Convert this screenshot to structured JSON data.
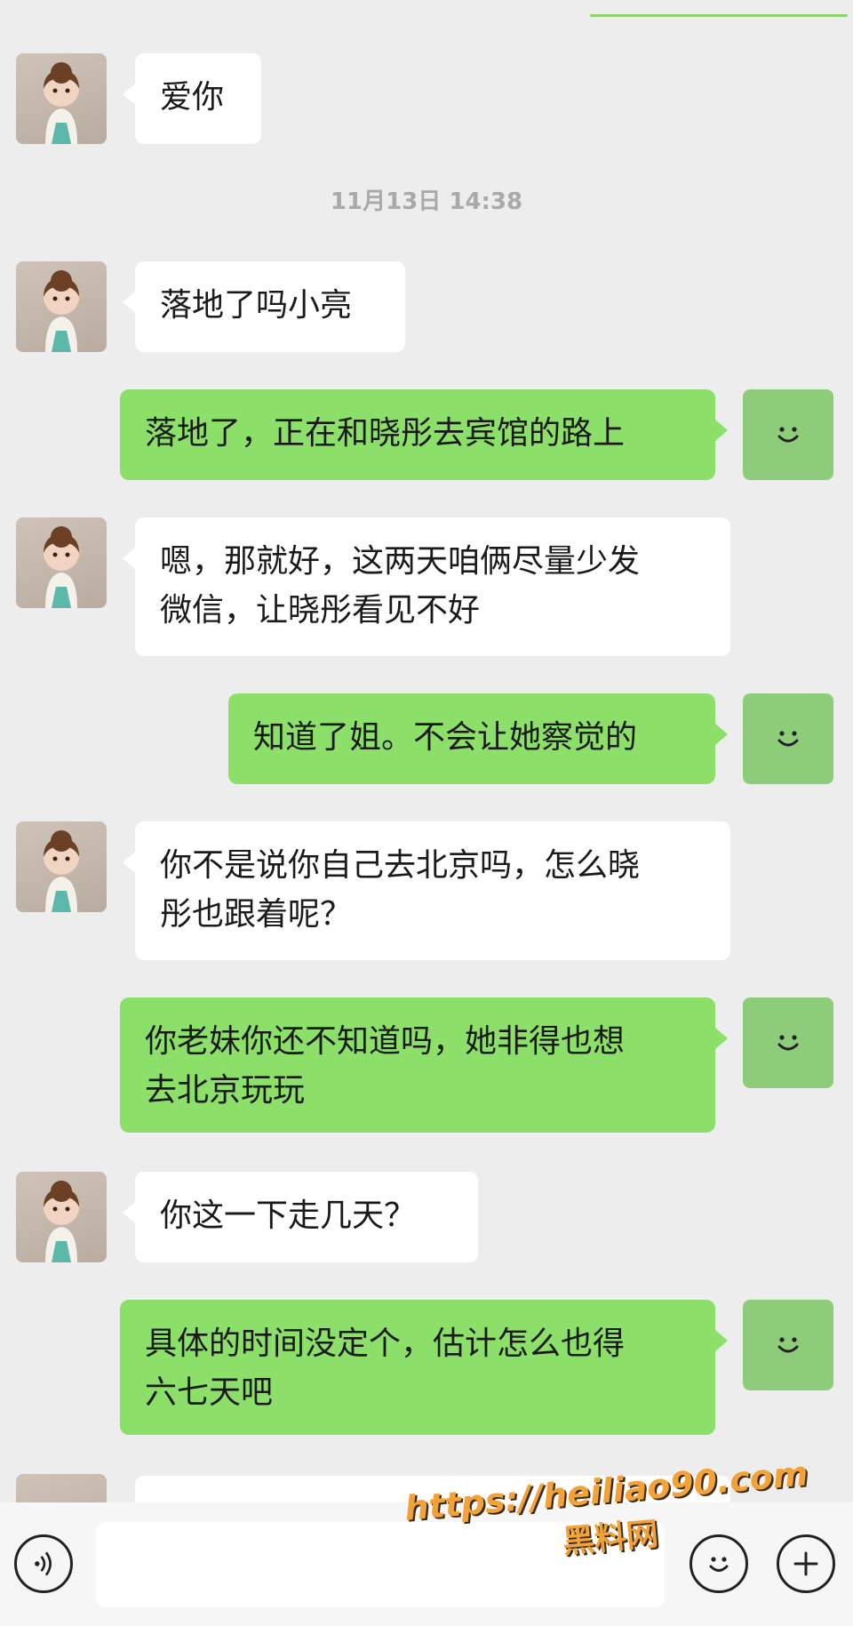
{
  "timestamp": "11月13日 14:38",
  "messages": [
    {
      "from": "them",
      "text": "爱你"
    },
    {
      "from": "them",
      "text": "落地了吗小亮"
    },
    {
      "from": "me",
      "text": "落地了，正在和晓彤去宾馆的路上"
    },
    {
      "from": "them",
      "text": "嗯，那就好，这两天咱俩尽量少发\n微信，让晓彤看见不好"
    },
    {
      "from": "me",
      "text": "知道了姐。不会让她察觉的"
    },
    {
      "from": "them",
      "text": "你不是说你自己去北京吗，怎么晓\n彤也跟着呢？"
    },
    {
      "from": "me",
      "text": "你老妹你还不知道吗，她非得也想\n去北京玩玩"
    },
    {
      "from": "them",
      "text": "你这一下走几天？"
    },
    {
      "from": "me",
      "text": "具体的时间没定个，估计怎么也得\n六七天吧"
    }
  ],
  "input": {
    "value": ""
  },
  "watermark": {
    "url": "https://heiliao90.com",
    "text": "黑料网"
  },
  "icons": {
    "voice": "voice-icon",
    "emoji": "emoji-icon",
    "plus": "plus-icon",
    "avatar_me": "smile-icon"
  },
  "colors": {
    "background": "#ededed",
    "bubble_in": "#ffffff",
    "bubble_out": "#8ce06a",
    "me_avatar": "#8dcc79",
    "watermark": "#f2a236"
  }
}
